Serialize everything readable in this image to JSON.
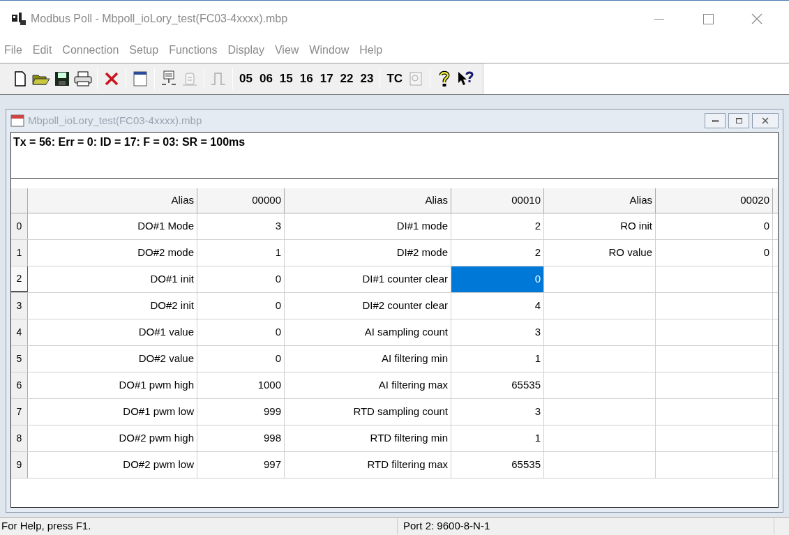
{
  "window": {
    "title": "Modbus Poll - Mbpoll_ioLory_test(FC03-4xxxx).mbp"
  },
  "menu": [
    "File",
    "Edit",
    "Connection",
    "Setup",
    "Functions",
    "Display",
    "View",
    "Window",
    "Help"
  ],
  "toolbar": {
    "function_codes": [
      "05",
      "06",
      "15",
      "16",
      "17",
      "22",
      "23"
    ],
    "tc": "TC"
  },
  "child": {
    "title": "Mbpoll_ioLory_test(FC03-4xxxx).mbp",
    "status_line": "Tx = 56: Err = 0: ID = 17: F = 03: SR = 100ms"
  },
  "grid": {
    "columns": [
      "Alias",
      "00000",
      "Alias",
      "00010",
      "Alias",
      "00020"
    ],
    "rows": [
      {
        "index": "0",
        "selected": false,
        "cells": [
          {
            "text": "DO#1 Mode",
            "selected": false
          },
          {
            "text": "3",
            "selected": false
          },
          {
            "text": "DI#1 mode",
            "selected": false
          },
          {
            "text": "2",
            "selected": false
          },
          {
            "text": "RO init",
            "selected": false
          },
          {
            "text": "0",
            "selected": false
          }
        ]
      },
      {
        "index": "1",
        "selected": false,
        "cells": [
          {
            "text": "DO#2 mode",
            "selected": false
          },
          {
            "text": "1",
            "selected": false
          },
          {
            "text": "DI#2 mode",
            "selected": false
          },
          {
            "text": "2",
            "selected": false
          },
          {
            "text": "RO value",
            "selected": false
          },
          {
            "text": "0",
            "selected": false
          }
        ]
      },
      {
        "index": "2",
        "selected": true,
        "cells": [
          {
            "text": "DO#1 init",
            "selected": false
          },
          {
            "text": "0",
            "selected": false
          },
          {
            "text": "DI#1 counter clear",
            "selected": false
          },
          {
            "text": "0",
            "selected": true
          }
        ]
      },
      {
        "index": "3",
        "selected": false,
        "cells": [
          {
            "text": "DO#2 init",
            "selected": false
          },
          {
            "text": "0",
            "selected": false
          },
          {
            "text": "DI#2 counter clear",
            "selected": false
          },
          {
            "text": "4",
            "selected": false
          }
        ]
      },
      {
        "index": "4",
        "selected": false,
        "cells": [
          {
            "text": "DO#1 value",
            "selected": false
          },
          {
            "text": "0",
            "selected": false
          },
          {
            "text": "AI sampling count",
            "selected": false
          },
          {
            "text": "3",
            "selected": false
          }
        ]
      },
      {
        "index": "5",
        "selected": false,
        "cells": [
          {
            "text": "DO#2 value",
            "selected": false
          },
          {
            "text": "0",
            "selected": false
          },
          {
            "text": "AI filtering min",
            "selected": false
          },
          {
            "text": "1",
            "selected": false
          }
        ]
      },
      {
        "index": "6",
        "selected": false,
        "cells": [
          {
            "text": "DO#1 pwm high",
            "selected": false
          },
          {
            "text": "1000",
            "selected": false
          },
          {
            "text": "AI filtering max",
            "selected": false
          },
          {
            "text": "65535",
            "selected": false
          }
        ]
      },
      {
        "index": "7",
        "selected": false,
        "cells": [
          {
            "text": "DO#1 pwm low",
            "selected": false
          },
          {
            "text": "999",
            "selected": false
          },
          {
            "text": "RTD sampling count",
            "selected": false
          },
          {
            "text": "3",
            "selected": false
          }
        ]
      },
      {
        "index": "8",
        "selected": false,
        "cells": [
          {
            "text": "DO#2 pwm high",
            "selected": false
          },
          {
            "text": "998",
            "selected": false
          },
          {
            "text": "RTD filtering min",
            "selected": false
          },
          {
            "text": "1",
            "selected": false
          }
        ]
      },
      {
        "index": "9",
        "selected": false,
        "cells": [
          {
            "text": "DO#2 pwm low",
            "selected": false
          },
          {
            "text": "997",
            "selected": false
          },
          {
            "text": "RTD filtering max",
            "selected": false
          },
          {
            "text": "65535",
            "selected": false
          }
        ]
      }
    ]
  },
  "status_bar": [
    "For Help, press F1.",
    "Port 2: 9600-8-N-1"
  ]
}
